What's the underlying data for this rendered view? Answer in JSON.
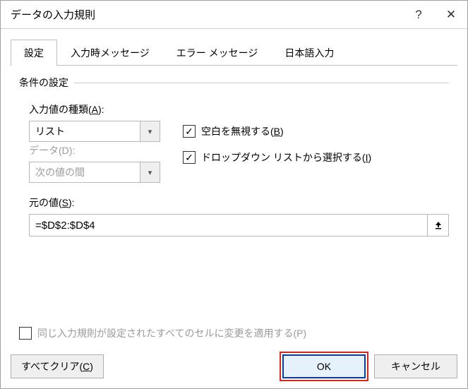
{
  "title": "データの入力規則",
  "tabs": {
    "settings": "設定",
    "input_message": "入力時メッセージ",
    "error_message": "エラー メッセージ",
    "ime": "日本語入力"
  },
  "group_label": "条件の設定",
  "allow": {
    "label_prefix": "入力値の種類(",
    "label_key": "A",
    "label_suffix": "):",
    "value": "リスト"
  },
  "data": {
    "label": "データ(D):",
    "value": "次の値の間"
  },
  "ignore_blank": {
    "checked": true,
    "label_prefix": "空白を無視する(",
    "label_key": "B",
    "label_suffix": ")"
  },
  "dropdown": {
    "checked": true,
    "label_prefix": "ドロップダウン リストから選択する(",
    "label_key": "I",
    "label_suffix": ")"
  },
  "source": {
    "label_prefix": "元の値(",
    "label_key": "S",
    "label_suffix": "):",
    "value": "=$D$2:$D$4"
  },
  "apply_all": {
    "checked": false,
    "label": "同じ入力規則が設定されたすべてのセルに変更を適用する(P)"
  },
  "buttons": {
    "clear_prefix": "すべてクリア(",
    "clear_key": "C",
    "clear_suffix": ")",
    "ok": "OK",
    "cancel": "キャンセル"
  },
  "icons": {
    "help": "?",
    "close": "✕",
    "chevron": "▾",
    "check": "✓",
    "range": "↥"
  }
}
